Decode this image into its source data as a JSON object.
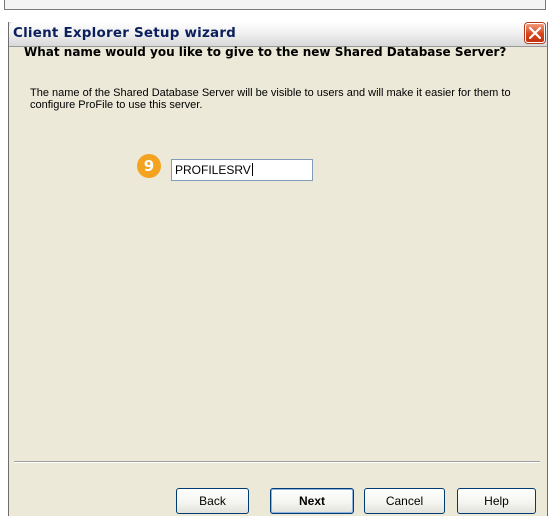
{
  "dialog": {
    "title": "Client Explorer Setup wizard",
    "question": "What name would you like to give to the new Shared Database Server?",
    "description": "The name of the Shared Database Server will be visible to users and will make it easier for them to configure ProFile to use this server.",
    "step_number": "9",
    "server_name_value": "PROFILESRV"
  },
  "buttons": {
    "back": "Back",
    "next": "Next",
    "cancel": "Cancel",
    "help": "Help"
  },
  "colors": {
    "dialog_background": "#ece9d8",
    "title_text": "#0b1f5c",
    "close_button": "#d9451b",
    "step_badge": "#f3a31f",
    "input_border": "#7f9db9"
  },
  "icons": {
    "close": "close-icon"
  }
}
